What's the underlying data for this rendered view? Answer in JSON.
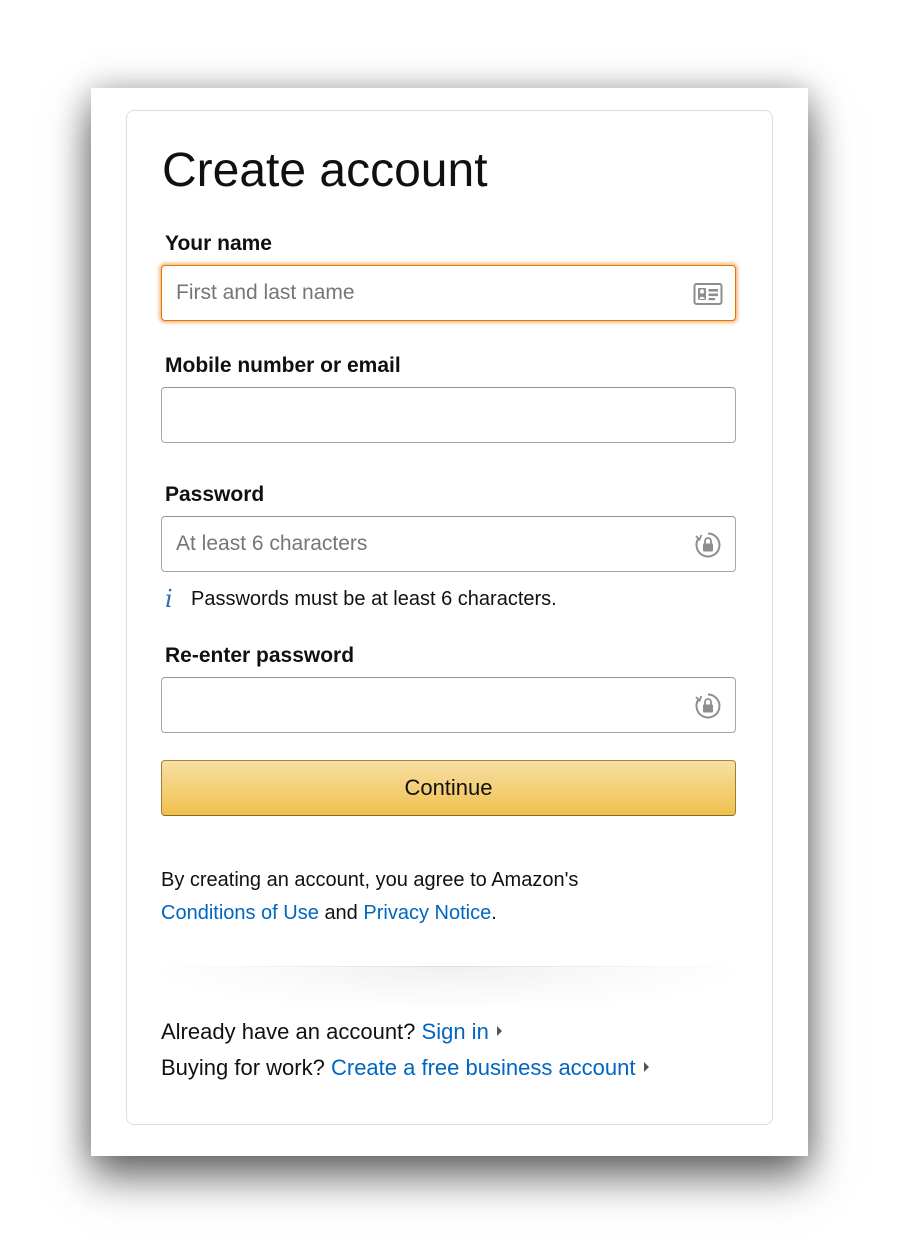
{
  "page": {
    "title": "Create account"
  },
  "form": {
    "name": {
      "label": "Your name",
      "placeholder": "First and last name",
      "value": "",
      "icon": "contact-card-icon"
    },
    "contact": {
      "label": "Mobile number or email",
      "placeholder": "",
      "value": ""
    },
    "password": {
      "label": "Password",
      "placeholder": "At least 6 characters",
      "value": "",
      "icon": "password-lock-icon",
      "hint": "Passwords must be at least 6 characters.",
      "hint_icon": "info-icon",
      "hint_glyph": "i"
    },
    "reenter_password": {
      "label": "Re-enter password",
      "placeholder": "",
      "value": "",
      "icon": "password-lock-icon"
    },
    "continue_label": "Continue"
  },
  "legal": {
    "prefix": "By creating an account, you agree to Amazon's",
    "conditions_link": "Conditions of Use",
    "and": "and",
    "privacy_link": "Privacy Notice",
    "suffix": "."
  },
  "footer": {
    "signin_prompt": "Already have an account?",
    "signin_link": "Sign in",
    "business_prompt": "Buying for work?",
    "business_link": "Create a free business account"
  },
  "colors": {
    "link": "#0066c0",
    "focus_border": "#e77600",
    "button_top": "#f7dfa5",
    "button_bottom": "#f0c14b",
    "info_icon": "#2b6cb0"
  }
}
